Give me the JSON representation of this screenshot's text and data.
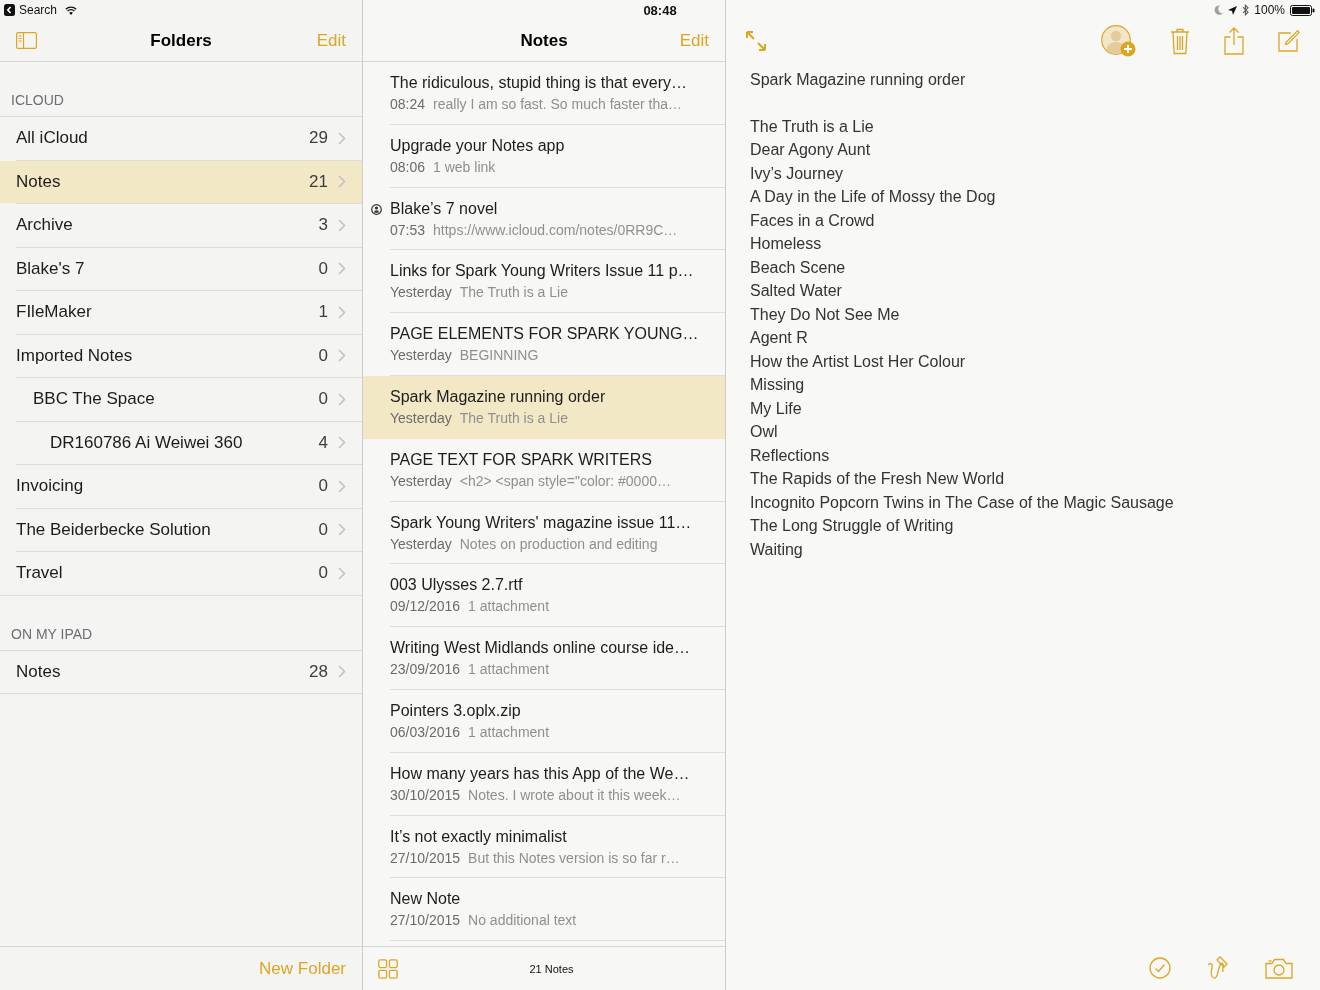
{
  "status_bar": {
    "back_label": "Search",
    "time": "08:48",
    "battery": "100%"
  },
  "folders_pane": {
    "title": "Folders",
    "edit": "Edit",
    "sections": [
      {
        "header": "ICLOUD",
        "folders": [
          {
            "name": "All iCloud",
            "count": "29",
            "selected": false
          },
          {
            "name": "Notes",
            "count": "21",
            "selected": true
          },
          {
            "name": "Archive",
            "count": "3",
            "selected": false
          },
          {
            "name": "Blake's 7",
            "count": "0",
            "selected": false
          },
          {
            "name": "FIleMaker",
            "count": "1",
            "selected": false
          },
          {
            "name": "Imported Notes",
            "count": "0",
            "selected": false,
            "children": [
              {
                "name": "BBC The Space",
                "count": "0",
                "selected": false,
                "children": [
                  {
                    "name": "DR160786 Ai Weiwei 360",
                    "count": "4",
                    "selected": false
                  }
                ]
              }
            ]
          },
          {
            "name": "Invoicing",
            "count": "0",
            "selected": false
          },
          {
            "name": "The Beiderbecke Solution",
            "count": "0",
            "selected": false
          },
          {
            "name": "Travel",
            "count": "0",
            "selected": false
          }
        ]
      },
      {
        "header": "ON MY IPAD",
        "folders": [
          {
            "name": "Notes",
            "count": "28",
            "selected": false
          }
        ]
      }
    ],
    "new_folder": "New Folder"
  },
  "notes_pane": {
    "title": "Notes",
    "edit": "Edit",
    "notes": [
      {
        "title": "The ridiculous, stupid thing is that every…",
        "date": "08:24",
        "preview": "really I am so fast. So much faster tha…",
        "shared": false,
        "selected": false
      },
      {
        "title": "Upgrade your Notes app",
        "date": "08:06",
        "preview": "1 web link",
        "shared": false,
        "selected": false
      },
      {
        "title": "Blake’s 7 novel",
        "date": "07:53",
        "preview": "https://www.icloud.com/notes/0RR9C…",
        "shared": true,
        "selected": false
      },
      {
        "title": "Links for Spark Young Writers Issue 11 p…",
        "date": "Yesterday",
        "preview": "The Truth is a Lie",
        "shared": false,
        "selected": false
      },
      {
        "title": "PAGE ELEMENTS FOR SPARK YOUNG…",
        "date": "Yesterday",
        "preview": "BEGINNING",
        "shared": false,
        "selected": false
      },
      {
        "title": "Spark Magazine running order",
        "date": "Yesterday",
        "preview": "The Truth is a Lie",
        "shared": false,
        "selected": true
      },
      {
        "title": "PAGE TEXT FOR SPARK WRITERS",
        "date": "Yesterday",
        "preview": "<h2> <span style=\"color: #0000…",
        "shared": false,
        "selected": false
      },
      {
        "title": "Spark Young Writers' magazine issue 11…",
        "date": "Yesterday",
        "preview": "Notes on production and editing",
        "shared": false,
        "selected": false
      },
      {
        "title": "003 Ulysses 2.7.rtf",
        "date": "09/12/2016",
        "preview": "1 attachment",
        "shared": false,
        "selected": false
      },
      {
        "title": "Writing West Midlands online course ide…",
        "date": "23/09/2016",
        "preview": "1 attachment",
        "shared": false,
        "selected": false
      },
      {
        "title": "Pointers 3.oplx.zip",
        "date": "06/03/2016",
        "preview": "1 attachment",
        "shared": false,
        "selected": false
      },
      {
        "title": "How many years has this App of the We…",
        "date": "30/10/2015",
        "preview": "Notes. I wrote about it this week…",
        "shared": false,
        "selected": false
      },
      {
        "title": "It’s not exactly minimalist",
        "date": "27/10/2015",
        "preview": "But this Notes version is so far r…",
        "shared": false,
        "selected": false
      },
      {
        "title": "New Note",
        "date": "27/10/2015",
        "preview": "No additional text",
        "shared": false,
        "selected": false
      }
    ],
    "count": "21 Notes"
  },
  "editor": {
    "heading": "Spark Magazine running order",
    "lines": [
      "The Truth is a Lie",
      "Dear Agony Aunt",
      "Ivy’s Journey",
      "A Day in the Life of Mossy the Dog",
      "Faces in a Crowd",
      "Homeless",
      "Beach Scene",
      "Salted Water",
      "They Do Not See Me",
      "Agent R",
      "How the Artist Lost Her Colour",
      "Missing",
      "My Life",
      "Owl",
      "Reflections",
      "The Rapids of the Fresh New World",
      "Incognito Popcorn Twins in The Case of the Magic Sausage",
      "The Long Struggle of Writing",
      "Waiting"
    ]
  }
}
